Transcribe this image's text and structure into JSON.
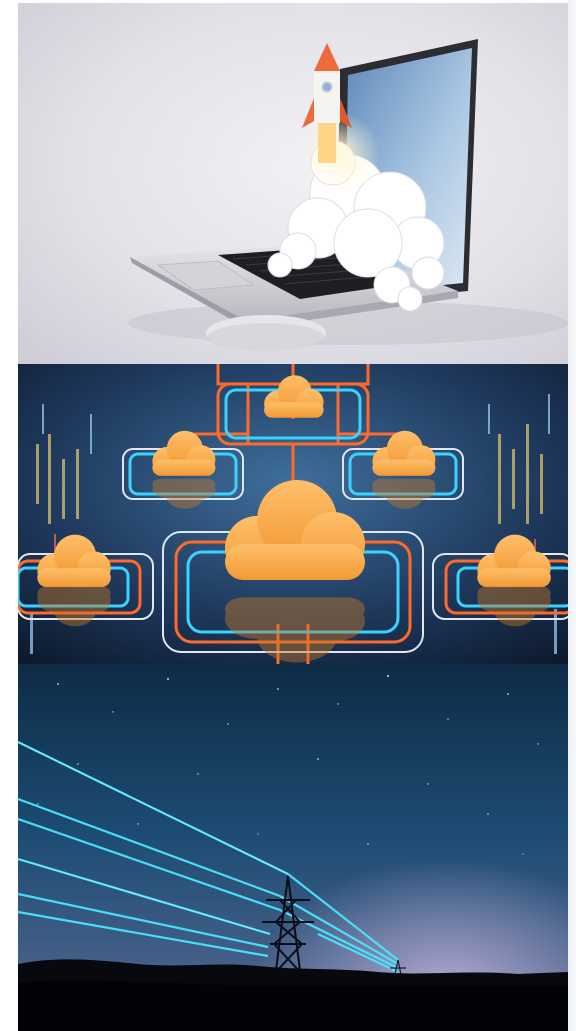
{
  "gallery": {
    "images": [
      {
        "name": "laptop-rocket-launch-image"
      },
      {
        "name": "cloud-network-circuit-image"
      },
      {
        "name": "power-line-night-sky-image"
      }
    ]
  }
}
